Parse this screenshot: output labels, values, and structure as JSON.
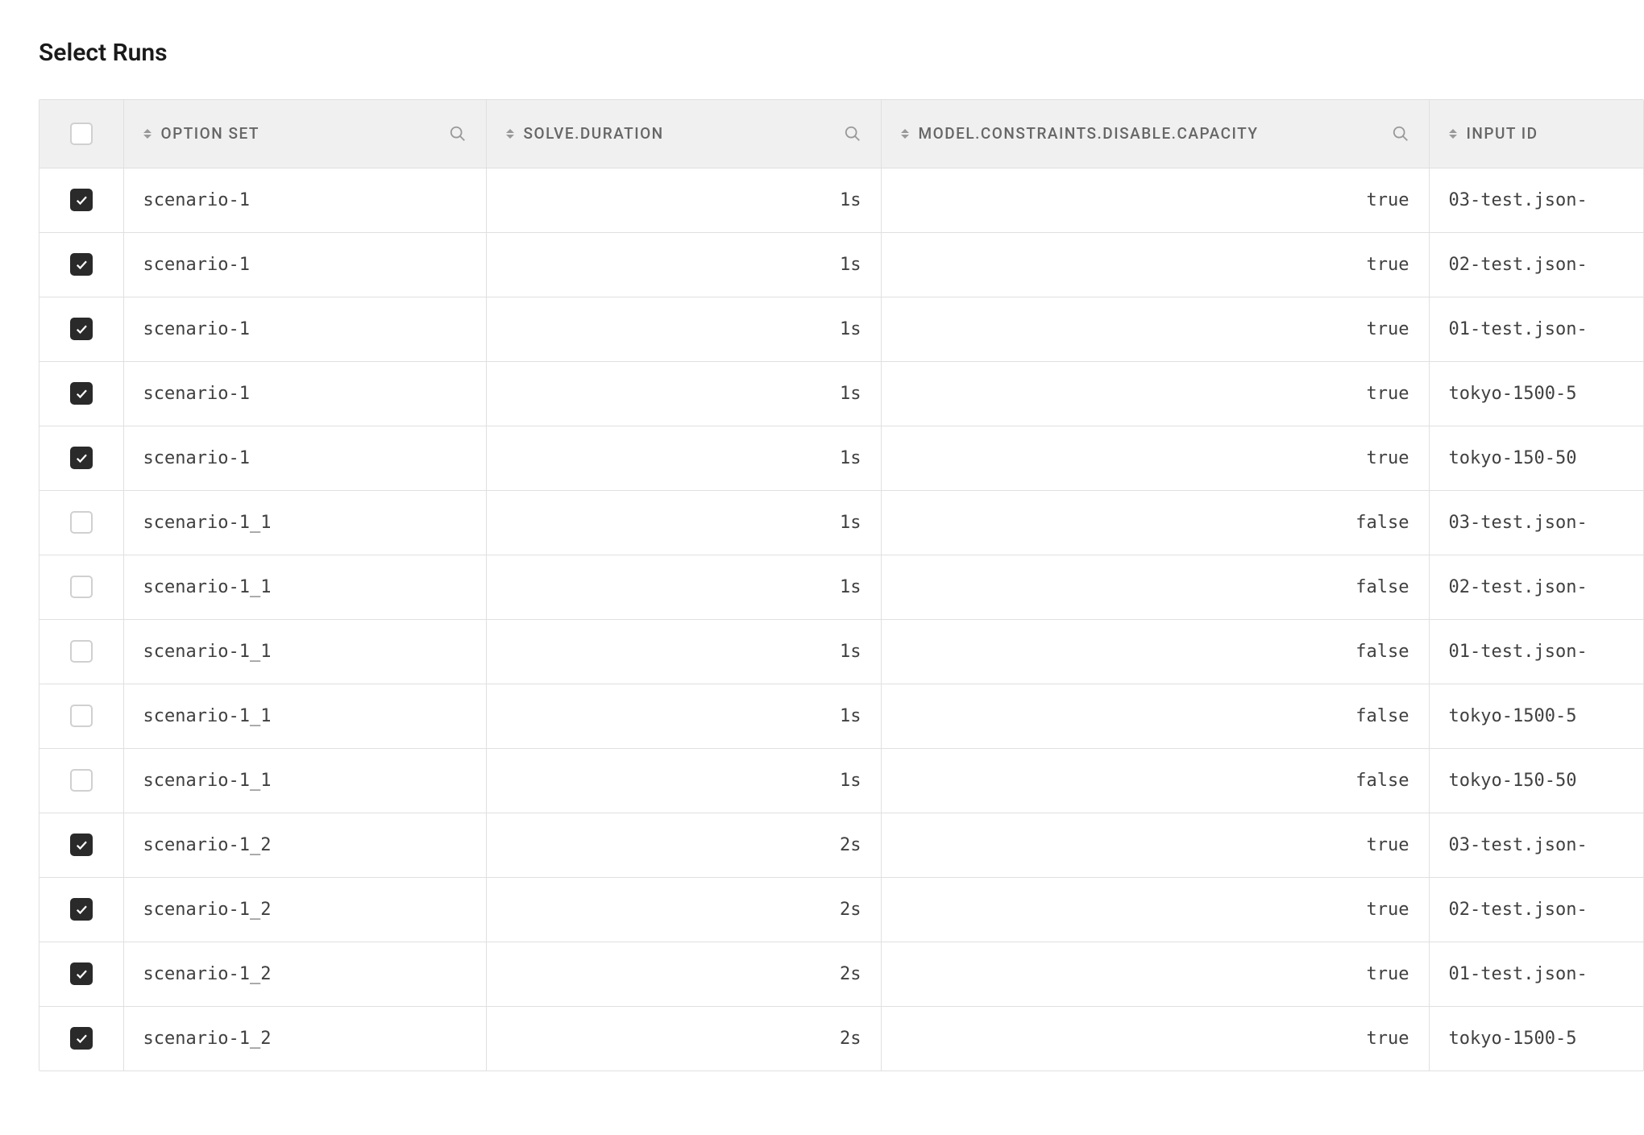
{
  "title": "Select Runs",
  "columns": {
    "option_set": "OPTION SET",
    "duration": "SOLVE.DURATION",
    "capacity": "MODEL.CONSTRAINTS.DISABLE.CAPACITY",
    "input_id": "INPUT ID"
  },
  "rows": [
    {
      "checked": true,
      "option_set": "scenario-1",
      "duration": "1s",
      "capacity": "true",
      "input_id": "03-test.json-"
    },
    {
      "checked": true,
      "option_set": "scenario-1",
      "duration": "1s",
      "capacity": "true",
      "input_id": "02-test.json-"
    },
    {
      "checked": true,
      "option_set": "scenario-1",
      "duration": "1s",
      "capacity": "true",
      "input_id": "01-test.json-"
    },
    {
      "checked": true,
      "option_set": "scenario-1",
      "duration": "1s",
      "capacity": "true",
      "input_id": "tokyo-1500-5"
    },
    {
      "checked": true,
      "option_set": "scenario-1",
      "duration": "1s",
      "capacity": "true",
      "input_id": "tokyo-150-50"
    },
    {
      "checked": false,
      "option_set": "scenario-1_1",
      "duration": "1s",
      "capacity": "false",
      "input_id": "03-test.json-"
    },
    {
      "checked": false,
      "option_set": "scenario-1_1",
      "duration": "1s",
      "capacity": "false",
      "input_id": "02-test.json-"
    },
    {
      "checked": false,
      "option_set": "scenario-1_1",
      "duration": "1s",
      "capacity": "false",
      "input_id": "01-test.json-"
    },
    {
      "checked": false,
      "option_set": "scenario-1_1",
      "duration": "1s",
      "capacity": "false",
      "input_id": "tokyo-1500-5"
    },
    {
      "checked": false,
      "option_set": "scenario-1_1",
      "duration": "1s",
      "capacity": "false",
      "input_id": "tokyo-150-50"
    },
    {
      "checked": true,
      "option_set": "scenario-1_2",
      "duration": "2s",
      "capacity": "true",
      "input_id": "03-test.json-"
    },
    {
      "checked": true,
      "option_set": "scenario-1_2",
      "duration": "2s",
      "capacity": "true",
      "input_id": "02-test.json-"
    },
    {
      "checked": true,
      "option_set": "scenario-1_2",
      "duration": "2s",
      "capacity": "true",
      "input_id": "01-test.json-"
    },
    {
      "checked": true,
      "option_set": "scenario-1_2",
      "duration": "2s",
      "capacity": "true",
      "input_id": "tokyo-1500-5"
    }
  ]
}
